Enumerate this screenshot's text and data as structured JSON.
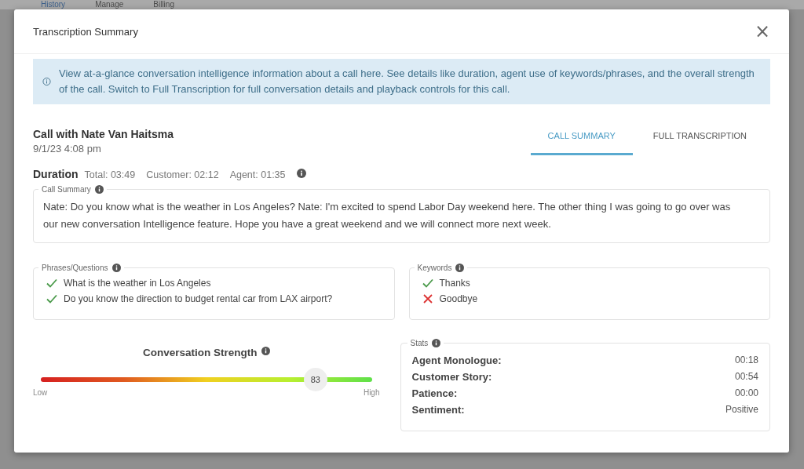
{
  "background_nav": [
    {
      "label": "History",
      "selected": true
    },
    {
      "label": "Manage",
      "selected": false
    },
    {
      "label": "Billing",
      "selected": false
    }
  ],
  "dialog": {
    "title": "Transcription Summary",
    "close": "×"
  },
  "info_banner": "View at-a-glance conversation intelligence information about a call here. See details like duration, agent use of keywords/phrases, and the overall strength of the call. Switch to Full Transcription for full conversation details and playback controls for this call.",
  "call": {
    "title": "Call with Nate Van Haitsma",
    "datetime": "9/1/23 4:08 pm"
  },
  "tabs": [
    {
      "label": "CALL SUMMARY",
      "selected": true
    },
    {
      "label": "FULL TRANSCRIPTION",
      "selected": false
    }
  ],
  "duration": {
    "label": "Duration",
    "items": [
      "Total: 03:49",
      "Customer: 02:12",
      "Agent: 01:35"
    ]
  },
  "call_summary": {
    "label": "Call Summary",
    "text": "Nate: Do you know what is the weather in Los Angeles? Nate: I'm excited to spend Labor Day weekend here. The other thing I was going to go over was our new conversation Intelligence feature. Hope you have a great weekend and we will connect more next week."
  },
  "phrases": {
    "label": "Phrases/Questions",
    "items": [
      {
        "text": "What is the weather in Los Angeles",
        "matched": true
      },
      {
        "text": "Do you know the direction to budget rental car from LAX airport?",
        "matched": true
      }
    ]
  },
  "keywords": {
    "label": "Keywords",
    "items": [
      {
        "text": "Thanks",
        "matched": true
      },
      {
        "text": "Goodbye",
        "matched": false
      }
    ]
  },
  "strength": {
    "label": "Conversation Strength",
    "level": 0.83,
    "reading": "83",
    "low": "Low",
    "high": "High"
  },
  "stats": {
    "label": "Stats",
    "rows": [
      {
        "name": "Agent Monologue:",
        "value": "00:18"
      },
      {
        "name": "Customer Story:",
        "value": "00:54"
      },
      {
        "name": "Patience:",
        "value": "00:00"
      },
      {
        "name": "Sentiment:",
        "value": "Positive"
      }
    ]
  }
}
